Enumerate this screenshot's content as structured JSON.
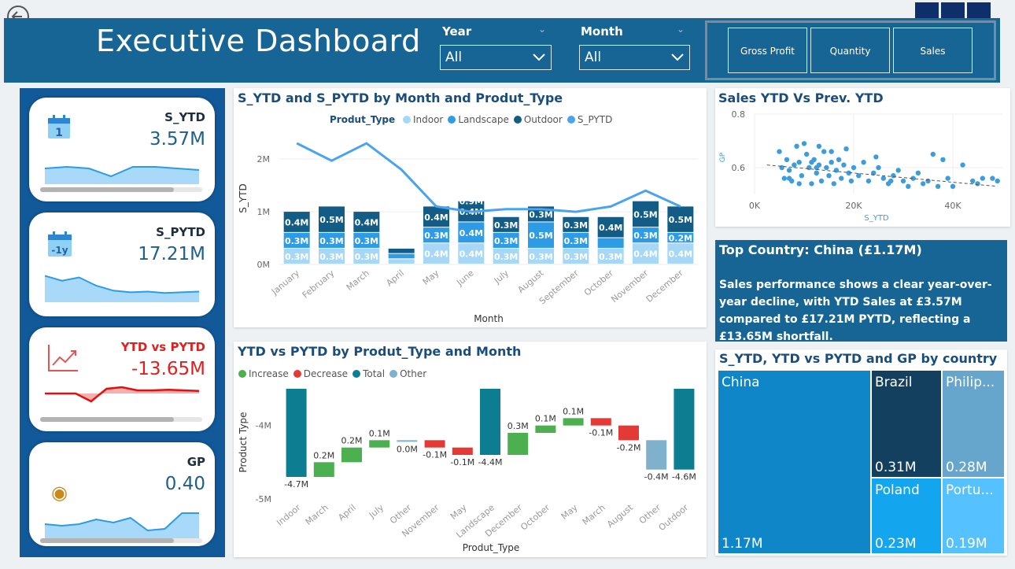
{
  "header": {
    "title": "Executive Dashboard",
    "filters": [
      {
        "label": "Year",
        "value": "All"
      },
      {
        "label": "Month",
        "value": "All"
      }
    ],
    "metric_buttons": [
      "Gross Profit",
      "Quantity",
      "Sales"
    ]
  },
  "kpis": [
    {
      "label": "S_YTD",
      "value": "3.57M",
      "icon": "calendar-icon",
      "label_color": "#1f2d3d",
      "spark": [
        0.5,
        0.55,
        0.5,
        0.25,
        0.55,
        0.55,
        0.5,
        0.45
      ]
    },
    {
      "label": "S_PYTD",
      "value": "17.21M",
      "icon": "calendar-minus-1y-icon",
      "icon_text": "-1y",
      "label_color": "#1f2d3d",
      "spark": [
        0.8,
        0.65,
        0.75,
        0.5,
        0.35,
        0.3,
        0.32,
        0.28,
        0.3,
        0.32
      ]
    },
    {
      "label": "YTD vs PYTD",
      "value": "-13.65M",
      "icon": "trend-chart-icon",
      "label_color": "#e02020",
      "spark": [
        0.7,
        0.7,
        0.7,
        0.45,
        0.85,
        0.9,
        0.8,
        0.8,
        0.82,
        0.8,
        0.78
      ]
    },
    {
      "label": "GP",
      "value": "0.40",
      "icon": "money-bag-icon",
      "label_color": "#1f2d3d",
      "spark": [
        0.5,
        0.45,
        0.5,
        0.65,
        0.55,
        0.7,
        0.3,
        0.35,
        0.85,
        0.85
      ]
    }
  ],
  "combo_chart": {
    "title": "S_YTD and S_PYTD by Month and Produt_Type",
    "legend_title": "Produt_Type",
    "xlabel": "Month",
    "ylabel": "S_YTD",
    "chart_data": {
      "type": "bar",
      "stacked": true,
      "categories": [
        "January",
        "February",
        "March",
        "April",
        "May",
        "June",
        "July",
        "August",
        "September",
        "October",
        "November",
        "December"
      ],
      "series": [
        {
          "name": "Indoor",
          "color": "#a6d7f7",
          "values": [
            0.3,
            0.3,
            0.3,
            0.1,
            0.4,
            0.4,
            0.3,
            0.3,
            0.3,
            0.3,
            0.4,
            0.4
          ],
          "labels": [
            "0.3M",
            "0.3M",
            "0.3M",
            "",
            "0.4M",
            "0.4M",
            "0.3M",
            "0.3M",
            "0.3M",
            "0.3M",
            "0.4M",
            "0.4M"
          ]
        },
        {
          "name": "Landscape",
          "color": "#2d9be6",
          "values": [
            0.3,
            0.3,
            0.3,
            0.1,
            0.3,
            0.4,
            0.3,
            0.5,
            0.3,
            0.2,
            0.3,
            0.2
          ],
          "labels": [
            "0.3M",
            "0.3M",
            "0.3M",
            "",
            "0.3M",
            "0.4M",
            "0.3M",
            "0.5M",
            "0.3M",
            "",
            "0.3M",
            "0.2M"
          ]
        },
        {
          "name": "Outdoor",
          "color": "#125c85",
          "values": [
            0.4,
            0.5,
            0.4,
            0.1,
            0.4,
            0.4,
            0.3,
            0.3,
            0.3,
            0.4,
            0.5,
            0.5
          ],
          "labels": [
            "0.4M",
            "0.5M",
            "0.4M",
            "",
            "0.4M",
            "0.4M",
            "0.3M",
            "0.3M",
            "0.3M",
            "0.4M",
            "0.5M",
            "0.5M"
          ]
        },
        {
          "name": "S_PYTD",
          "color": "#4aa3f0",
          "type": "line",
          "values": [
            2.3,
            1.97,
            2.3,
            1.8,
            1.1,
            1.0,
            1.05,
            1.05,
            1.0,
            1.1,
            1.4,
            1.1
          ]
        }
      ],
      "extra_labels": [
        "",
        "",
        "",
        "",
        "",
        "0.9M",
        "",
        "",
        "",
        "",
        "",
        ""
      ],
      "yticks": [
        "0M",
        "1M",
        "2M"
      ],
      "ylim": [
        0,
        2.6
      ]
    }
  },
  "scatter_chart": {
    "title": "Sales YTD Vs Prev. YTD",
    "xlabel": "S_YTD",
    "ylabel": "GP",
    "chart_data": {
      "type": "scatter",
      "xticks": [
        "0K",
        "20K",
        "40K"
      ],
      "yticks": [
        "0.6",
        "0.8"
      ],
      "xlim": [
        0,
        50000
      ],
      "ylim": [
        0.5,
        0.8
      ],
      "trendline": true,
      "color": "#3d9ddb",
      "points": [
        [
          5000,
          0.66
        ],
        [
          5500,
          0.6
        ],
        [
          6000,
          0.56
        ],
        [
          6500,
          0.63
        ],
        [
          7000,
          0.59
        ],
        [
          7500,
          0.55
        ],
        [
          8000,
          0.61
        ],
        [
          8500,
          0.68
        ],
        [
          9000,
          0.62
        ],
        [
          9500,
          0.57
        ],
        [
          10000,
          0.69
        ],
        [
          10500,
          0.65
        ],
        [
          11000,
          0.6
        ],
        [
          11500,
          0.54
        ],
        [
          12000,
          0.63
        ],
        [
          12500,
          0.58
        ],
        [
          13000,
          0.61
        ],
        [
          13500,
          0.55
        ],
        [
          14000,
          0.66
        ],
        [
          14500,
          0.6
        ],
        [
          15000,
          0.57
        ],
        [
          15500,
          0.62
        ],
        [
          16000,
          0.54
        ],
        [
          16500,
          0.59
        ],
        [
          17000,
          0.63
        ],
        [
          17500,
          0.56
        ],
        [
          18000,
          0.61
        ],
        [
          18500,
          0.67
        ],
        [
          19000,
          0.58
        ],
        [
          19500,
          0.55
        ],
        [
          20000,
          0.6
        ],
        [
          21000,
          0.57
        ],
        [
          22000,
          0.62
        ],
        [
          23000,
          0.55
        ],
        [
          24000,
          0.58
        ],
        [
          25000,
          0.6
        ],
        [
          26000,
          0.56
        ],
        [
          27000,
          0.54
        ],
        [
          28000,
          0.57
        ],
        [
          29000,
          0.59
        ],
        [
          30000,
          0.55
        ],
        [
          31000,
          0.53
        ],
        [
          32000,
          0.56
        ],
        [
          33000,
          0.58
        ],
        [
          34000,
          0.54
        ],
        [
          35000,
          0.55
        ],
        [
          36000,
          0.65
        ],
        [
          37000,
          0.53
        ],
        [
          38000,
          0.63
        ],
        [
          39000,
          0.56
        ],
        [
          40000,
          0.53
        ],
        [
          42000,
          0.61
        ],
        [
          44000,
          0.55
        ],
        [
          45000,
          0.54
        ],
        [
          46000,
          0.56
        ],
        [
          48000,
          0.56
        ],
        [
          49000,
          0.55
        ],
        [
          12500,
          0.6
        ],
        [
          9000,
          0.54
        ],
        [
          15500,
          0.66
        ],
        [
          13000,
          0.68
        ],
        [
          11500,
          0.62
        ],
        [
          24500,
          0.64
        ],
        [
          27500,
          0.55
        ],
        [
          7000,
          0.56
        ]
      ]
    }
  },
  "top_country": {
    "heading": "Top Country: China (£1.17M)",
    "text": "Sales performance shows a clear year-over-year decline, with YTD Sales at £3.57M compared to £17.21M PYTD, reflecting a £13.65M shortfall."
  },
  "waterfall_chart": {
    "title": "YTD vs PYTD by Produt_Type and Month",
    "xlabel": "Produt_Type",
    "ylabel": "Product Type",
    "legend": [
      {
        "name": "Increase",
        "color": "#4caf50"
      },
      {
        "name": "Decrease",
        "color": "#e53935"
      },
      {
        "name": "Total",
        "color": "#0d7e91"
      },
      {
        "name": "Other",
        "color": "#7fb0cc"
      }
    ],
    "chart_data": {
      "type": "waterfall",
      "yticks": [
        "-5M",
        "-4M"
      ],
      "ylim": [
        -5.0,
        -3.5
      ],
      "steps": [
        {
          "label": "Indoor",
          "kind": "total",
          "value": -4.7,
          "text": "-4.7M"
        },
        {
          "label": "March",
          "kind": "increase",
          "value": 0.2,
          "text": "0.2M"
        },
        {
          "label": "April",
          "kind": "increase",
          "value": 0.2,
          "text": "0.2M"
        },
        {
          "label": "July",
          "kind": "increase",
          "value": 0.1,
          "text": "0.1M"
        },
        {
          "label": "Other",
          "kind": "other",
          "value": 0.0,
          "text": "0.0M"
        },
        {
          "label": "November",
          "kind": "decrease",
          "value": -0.1,
          "text": "-0.1M"
        },
        {
          "label": "May",
          "kind": "decrease",
          "value": -0.1,
          "text": "-0.1M"
        },
        {
          "label": "Landscape",
          "kind": "total",
          "value": -4.4,
          "text": "-4.4M"
        },
        {
          "label": "December",
          "kind": "increase",
          "value": 0.3,
          "text": "0.3M"
        },
        {
          "label": "October",
          "kind": "increase",
          "value": 0.1,
          "text": "0.1M"
        },
        {
          "label": "May",
          "kind": "increase",
          "value": 0.1,
          "text": "0.1M"
        },
        {
          "label": "March",
          "kind": "decrease",
          "value": -0.1,
          "text": "-0.1M"
        },
        {
          "label": "August",
          "kind": "decrease",
          "value": -0.2,
          "text": "-0.2M"
        },
        {
          "label": "Other",
          "kind": "other",
          "value": -0.4,
          "text": "-0.4M"
        },
        {
          "label": "Outdoor",
          "kind": "total",
          "value": -4.6,
          "text": "-4.6M"
        }
      ]
    }
  },
  "treemap": {
    "title": "S_YTD, YTD vs PYTD and GP by country",
    "chart_data": {
      "type": "treemap",
      "items": [
        {
          "name": "China",
          "value": "1.17M",
          "color": "#0e86c8"
        },
        {
          "name": "Brazil",
          "value": "0.31M",
          "color": "#13405e"
        },
        {
          "name": "Philip...",
          "value": "0.28M",
          "color": "#67a6cc"
        },
        {
          "name": "Poland",
          "value": "0.23M",
          "color": "#13a6ee"
        },
        {
          "name": "Portu...",
          "value": "0.19M",
          "color": "#55c2ff"
        }
      ]
    }
  }
}
